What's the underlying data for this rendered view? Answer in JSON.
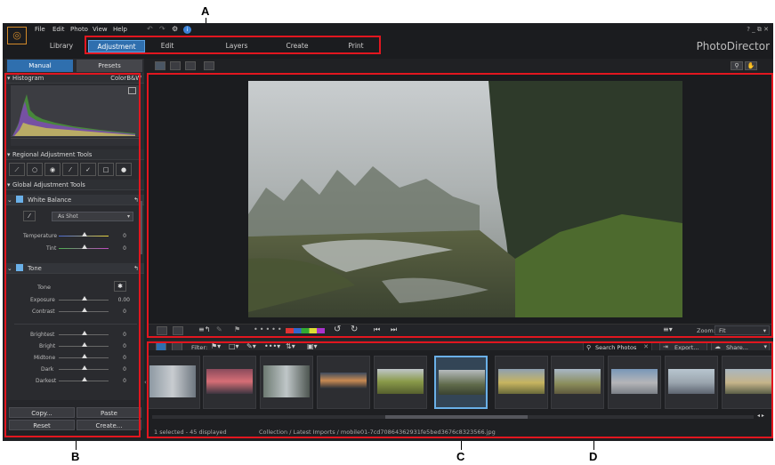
{
  "callouts": {
    "a": "A",
    "b": "B",
    "c": "C",
    "d": "D"
  },
  "menu": {
    "file": "File",
    "edit": "Edit",
    "photo": "Photo",
    "view": "View",
    "help": "Help"
  },
  "window_controls": "? _ ⧉ ✕",
  "nav_tabs": [
    "Library",
    "Adjustment",
    "Edit",
    "Layers",
    "Create",
    "Print"
  ],
  "brand": "PhotoDirector",
  "left_tabs": {
    "manual": "Manual",
    "presets": "Presets"
  },
  "histogram": {
    "title": "Histogram",
    "color": "Color",
    "bw": "B&W"
  },
  "regional": {
    "title": "Regional Adjustment Tools"
  },
  "global": {
    "title": "Global Adjustment Tools"
  },
  "white_balance": {
    "title": "White Balance",
    "preset": "As Shot",
    "temperature": "Temperature",
    "tint": "Tint",
    "temp_val": "0",
    "tint_val": "0"
  },
  "tone": {
    "title": "Tone",
    "subtitle": "Tone",
    "exposure": "Exposure",
    "exposure_val": "0.00",
    "contrast": "Contrast",
    "contrast_val": "0",
    "brightest": "Brightest",
    "bright": "Bright",
    "midtone": "Midtone",
    "dark": "Dark",
    "darkest": "Darkest",
    "brightest_val": "0",
    "bright_val": "0",
    "midtone_val": "0",
    "dark_val": "0",
    "darkest_val": "0"
  },
  "bottom_buttons": {
    "copy": "Copy...",
    "paste": "Paste",
    "reset": "Reset",
    "create": "Create..."
  },
  "viewer": {
    "zoom_label": "Zoom:",
    "zoom_value": "Fit"
  },
  "filmstrip": {
    "filter": "Filter:",
    "search_placeholder": "Search Photos",
    "export": "Export...",
    "share": "Share..."
  },
  "status": {
    "count": "1 selected - 45 displayed",
    "path": "Collection / Latest Imports / mobile01-7cd70864362931fe5bed3676c8323566.jpg"
  },
  "colors": {
    "accent": "#2f6fae",
    "annotation": "#e2161f",
    "panel": "#2a2b2f"
  }
}
